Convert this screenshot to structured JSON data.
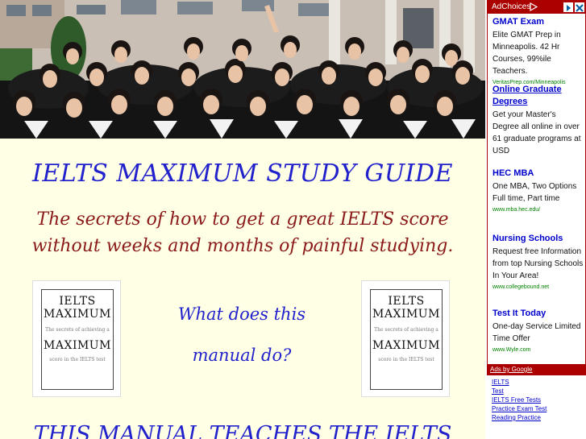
{
  "main": {
    "title": "IELTS MAXIMUM STUDY GUIDE",
    "subtitle": "The secrets of how to get a great IELTS score without weeks and months of painful studying.",
    "question_line1": "What does this",
    "question_line2": "manual do?",
    "bottom_text": "THIS MANUAL TEACHES THE IELTS"
  },
  "book": {
    "line1": "IELTS",
    "line2": "MAXIMUM",
    "small1": "The secrets of achieving a",
    "line3": "MAXIMUM",
    "small2": "score in the IELTS test"
  },
  "ads": {
    "adchoices_label": "AdChoices",
    "items": [
      {
        "title": "GMAT Exam",
        "text": "Elite GMAT Prep in Minneapolis. 42 Hr Courses, 99%ile Teachers.",
        "url": "VeritasPrep.com/Minneapolis"
      },
      {
        "title": "Online Graduate Degrees",
        "text": "Get your Master's Degree all online in over 61 graduate programs at USD",
        "url": ""
      },
      {
        "title": "HEC MBA",
        "text": "One MBA, Two Options Full time, Part time",
        "url": "www.mba.hec.edu/"
      },
      {
        "title": "Nursing Schools",
        "text": "Request free Information from top Nursing Schools In Your Area!",
        "url": "www.collegebound.net"
      },
      {
        "title": "Test It Today",
        "text": "One-day Service Limited Time Offer",
        "url": "www.Wyle.com"
      }
    ],
    "google_label": "Ads by Google",
    "google_links": [
      "IELTS",
      "Test",
      "IELTS Free Tests",
      "Practice Exam Test",
      "Reading Practice"
    ]
  },
  "colors": {
    "title_blue": "#2222cc",
    "subtitle_red": "#8b1a1a",
    "page_bg": "#ffffe6",
    "ad_red": "#aa0000"
  }
}
